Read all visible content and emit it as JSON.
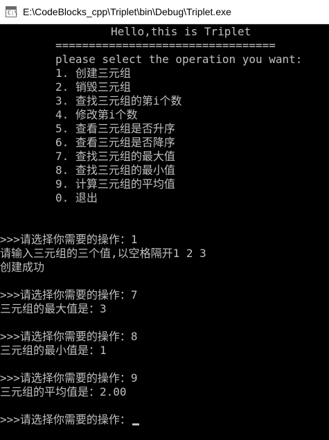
{
  "window": {
    "title": "E:\\CodeBlocks_cpp\\Triplet\\bin\\Debug\\Triplet.exe",
    "icon": "console-app-icon"
  },
  "menu": {
    "header": "Hello,this is Triplet",
    "separator": "=================================",
    "prompt": "please select the operation you want:",
    "items": [
      "1. 创建三元组",
      "2. 销毁三元组",
      "3. 查找三元组的第i个数",
      "4. 修改第i个数",
      "5. 查看三元组是否升序",
      "6. 查看三元组是否降序",
      "7. 查找三元组的最大值",
      "8. 查找三元组的最小值",
      "9. 计算三元组的平均值",
      "0. 退出"
    ]
  },
  "session": {
    "op1": ">>>请选择你需要的操作：1",
    "input_prompt": "请输入三元组的三个值,以空格隔开1 2 3",
    "created": "创建成功",
    "op7": ">>>请选择你需要的操作：7",
    "max_result": "三元组的最大值是：3",
    "op8": ">>>请选择你需要的操作：8",
    "min_result": "三元组的最小值是：1",
    "op9": ">>>请选择你需要的操作：9",
    "avg_result": "三元组的平均值是：2.00",
    "final_prompt": ">>>请选择你需要的操作："
  },
  "colors": {
    "console_bg": "#000000",
    "console_text": "#c0c0c0",
    "titlebar_bg": "#ffffff"
  }
}
